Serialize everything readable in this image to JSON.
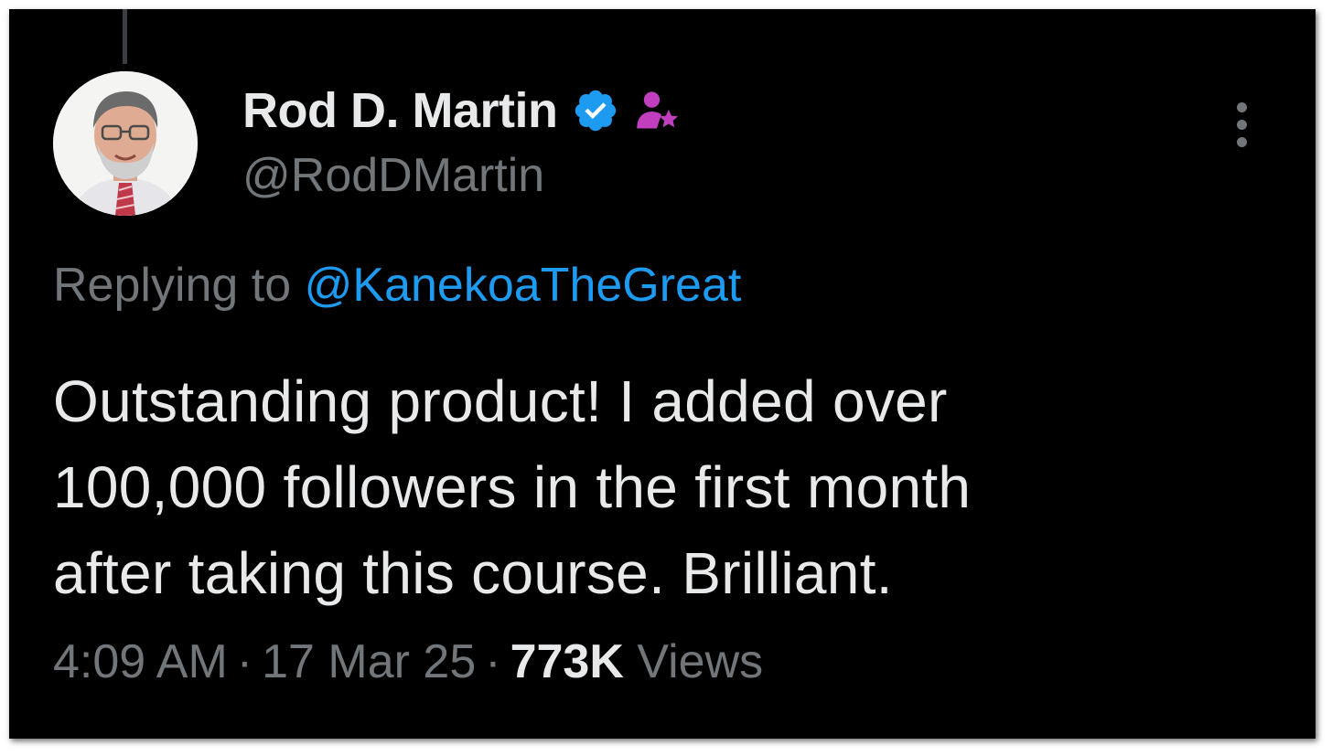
{
  "tweet": {
    "author": {
      "display_name": "Rod D. Martin",
      "handle": "@RodDMartin",
      "avatar_icon": "user-avatar-photo",
      "verified_icon": "verified-badge-icon",
      "affiliate_icon": "affiliate-person-star-icon"
    },
    "reply": {
      "prefix": "Replying to",
      "mention": "@KanekoaTheGreat"
    },
    "text_lines": [
      "Outstanding product! I added over",
      "100,000 followers in the first month",
      "after taking this course. Brilliant."
    ],
    "meta": {
      "time": "4:09 AM",
      "separator": "·",
      "date": "17 Mar 25",
      "views_count": "773K",
      "views_label": "Views"
    },
    "more_icon": "more-vertical-icon"
  },
  "colors": {
    "background": "#000000",
    "primary_text": "#e7e9ea",
    "secondary_text": "#71767b",
    "link": "#1d9bf0",
    "verified": "#1d9bf0",
    "affiliate": "#c13fbf"
  }
}
